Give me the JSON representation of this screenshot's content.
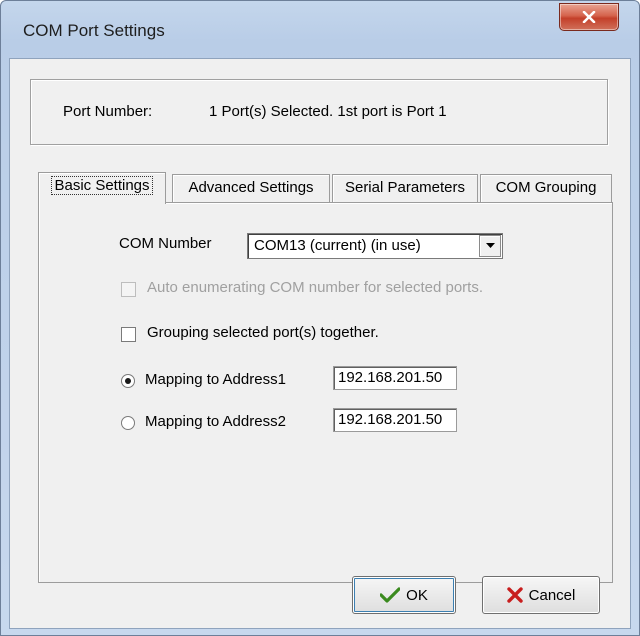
{
  "window": {
    "title": "COM Port Settings",
    "close_glyph": "X"
  },
  "port": {
    "label": "Port Number:",
    "value": "1 Port(s) Selected. 1st port is Port 1"
  },
  "tabs": [
    {
      "label": "Basic Settings",
      "active": true
    },
    {
      "label": "Advanced Settings",
      "active": false
    },
    {
      "label": "Serial Parameters",
      "active": false
    },
    {
      "label": "COM Grouping",
      "active": false
    }
  ],
  "basic": {
    "com_number_label": "COM Number",
    "com_number_value": "COM13 (current) (in use)",
    "auto_enum_label": "Auto enumerating COM number for selected ports.",
    "auto_enum_checked": false,
    "auto_enum_enabled": false,
    "grouping_label": "Grouping selected port(s) together.",
    "grouping_checked": false,
    "address1_label": "Mapping to Address1",
    "address1_value": "192.168.201.50",
    "address1_selected": true,
    "address2_label": "Mapping to Address2",
    "address2_value": "192.168.201.50",
    "address2_selected": false
  },
  "buttons": {
    "ok_label": "OK",
    "cancel_label": "Cancel"
  },
  "colors": {
    "ok_check": "#3a8a1e",
    "cancel_x": "#c81e1e",
    "close_button": "#c4402a"
  },
  "icons": {
    "ok": "check-icon",
    "cancel": "x-icon",
    "close": "close-icon"
  }
}
